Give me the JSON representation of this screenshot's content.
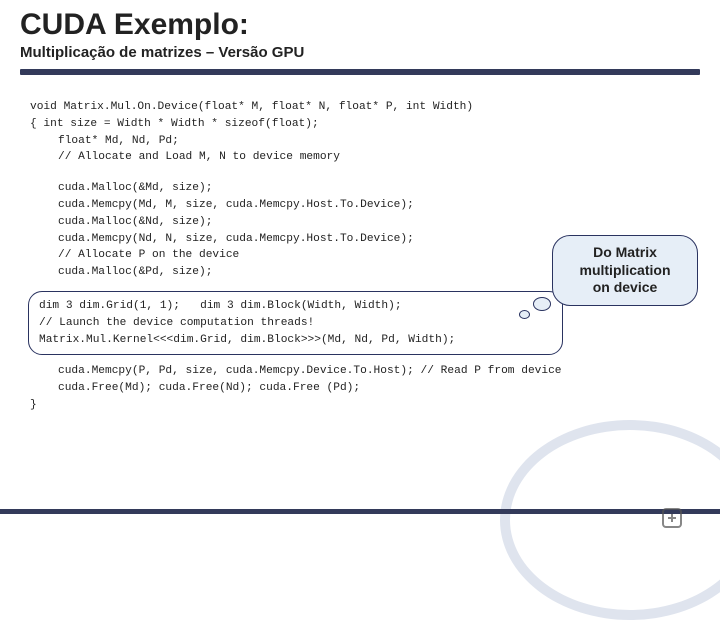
{
  "header": {
    "title": "CUDA Exemplo:",
    "subtitle": "Multiplicação de matrizes – Versão GPU"
  },
  "callout": {
    "line1": "Do Matrix",
    "line2": "multiplication",
    "line3": "on device"
  },
  "code": {
    "l01": "void Matrix.Mul.On.Device(float* M, float* N, float* P, int Width)",
    "l02": "{ int size = Width * Width * sizeof(float);",
    "l03": "float* Md, Nd, Pd;",
    "l04": "// Allocate and Load M, N to device memory",
    "l05": "cuda.Malloc(&Md, size);",
    "l06": "cuda.Memcpy(Md, M, size, cuda.Memcpy.Host.To.Device);",
    "l07": "cuda.Malloc(&Nd, size);",
    "l08": "cuda.Memcpy(Nd, N, size, cuda.Memcpy.Host.To.Device);",
    "l09": "// Allocate P on the device",
    "l10": "cuda.Malloc(&Pd, size);",
    "b1": "dim 3 dim.Grid(1, 1);   dim 3 dim.Block(Width, Width);",
    "b2": "// Launch the device computation threads!",
    "b3": "Matrix.Mul.Kernel<<<dim.Grid, dim.Block>>>(Md, Nd, Pd, Width);",
    "l11": "cuda.Memcpy(P, Pd, size, cuda.Memcpy.Device.To.Host); // Read P from device",
    "l12": "cuda.Free(Md); cuda.Free(Nd); cuda.Free (Pd);",
    "l13": "}"
  }
}
